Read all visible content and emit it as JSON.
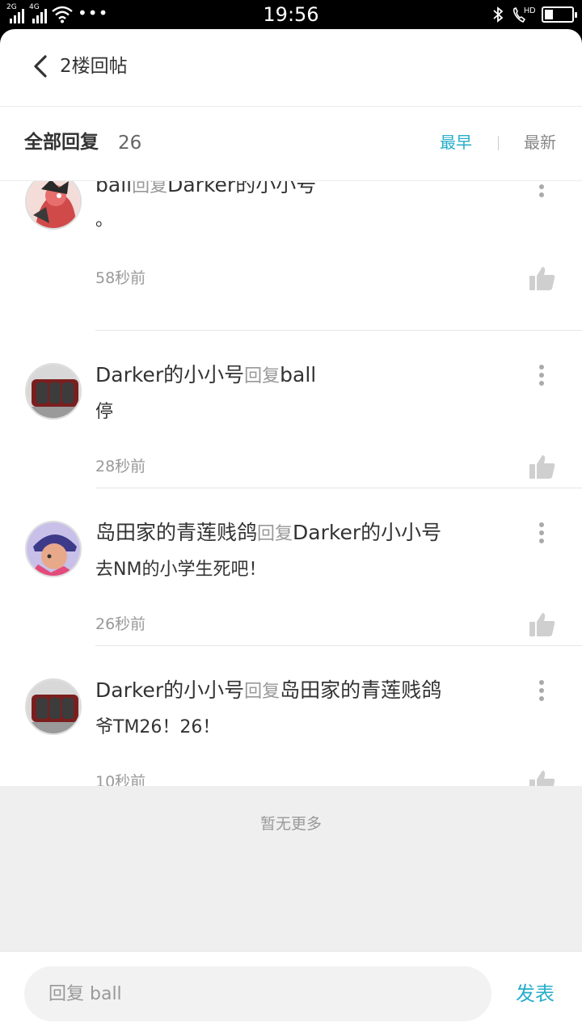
{
  "status_bar": {
    "net_1": "2G",
    "net_2": "4G",
    "time": "19:56",
    "bluetooth_icon": "bluetooth-icon",
    "call_icon": "hd-call-icon",
    "hd_label": "HD",
    "battery_level": 0.3
  },
  "nav": {
    "back_icon": "chevron-left-icon",
    "title": "2楼回帖"
  },
  "filter": {
    "title": "全部回复",
    "count": "26",
    "sort_earliest": "最早",
    "sort_newest": "最新"
  },
  "reply_verb": "回复",
  "replies": [
    {
      "author": "ball",
      "target": "Darker的小小号",
      "content": "。",
      "time": "58秒前",
      "avatar_colors": [
        "#f4dcd8",
        "#d04a4a",
        "#2a2a2a"
      ]
    },
    {
      "author": "Darker的小小号",
      "target": "ball",
      "content": "停",
      "time": "28秒前",
      "avatar_colors": [
        "#cfcfcf",
        "#7a1f1f",
        "#3c3c3c"
      ]
    },
    {
      "author": "岛田家的青莲贱鸽",
      "target": "Darker的小小号",
      "content": "去NM的小学生死吧！",
      "time": "26秒前",
      "avatar_colors": [
        "#c8c0e8",
        "#3d3a8a",
        "#e8a88a"
      ]
    },
    {
      "author": "Darker的小小号",
      "target": "岛田家的青莲贱鸽",
      "content": "爷TM26！26！",
      "time": "10秒前",
      "avatar_colors": [
        "#cfcfcf",
        "#7a1f1f",
        "#3c3c3c"
      ]
    }
  ],
  "no_more": "暂无更多",
  "bottom": {
    "placeholder": "回复 ball",
    "send_label": "发表"
  },
  "colors": {
    "accent": "#27aec9",
    "muted": "#999999"
  }
}
